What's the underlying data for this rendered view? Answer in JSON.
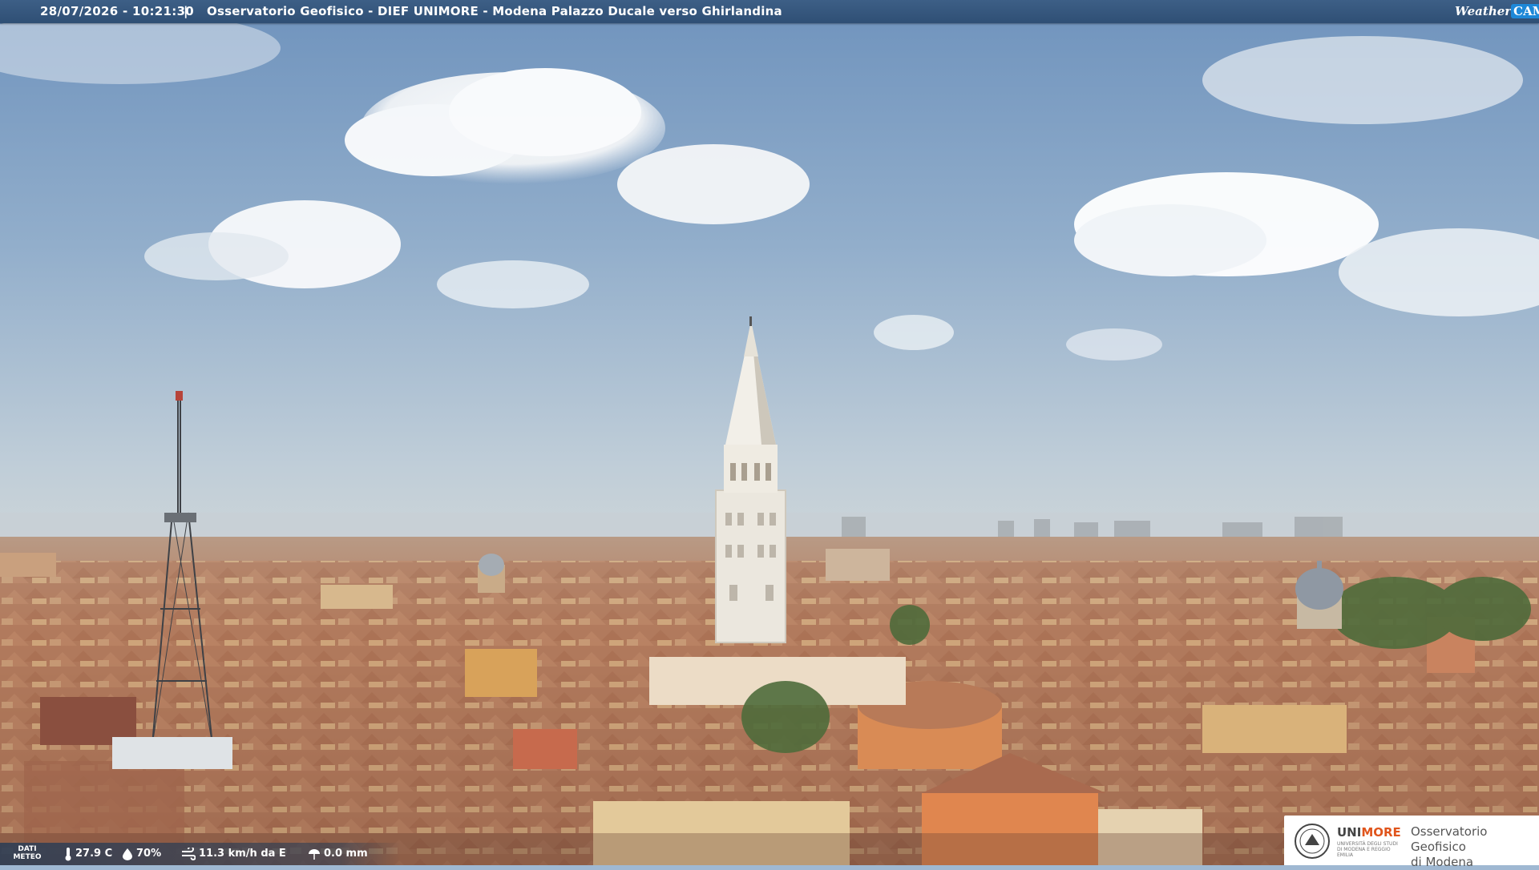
{
  "header": {
    "timestamp": "28/07/2026 - 10:21:30",
    "separator": "|",
    "title": "Osservatorio Geofisico - DIEF UNIMORE - Modena Palazzo Ducale verso Ghirlandina",
    "logo_text_1": "Weather",
    "logo_text_2": "CAM"
  },
  "weather": {
    "label": "DATI METEO",
    "temperature": "27.9 C",
    "humidity": "70%",
    "wind": "11.3 km/h da E",
    "rain": "0.0 mm"
  },
  "branding": {
    "university_prefix": "UNI",
    "university_suffix": "MORE",
    "university_subtitle": "UNIVERSITÀ DEGLI STUDI DI MODENA E REGGIO EMILIA",
    "observatory_line1": "Osservatorio Geofisico",
    "observatory_line2": "di Modena"
  },
  "colors": {
    "sky_top": "#7f9fc4",
    "sky_horizon": "#c9d3d8",
    "roof": "#b5785a",
    "tower": "#e9e5dc",
    "header_bg": "#34557c"
  }
}
